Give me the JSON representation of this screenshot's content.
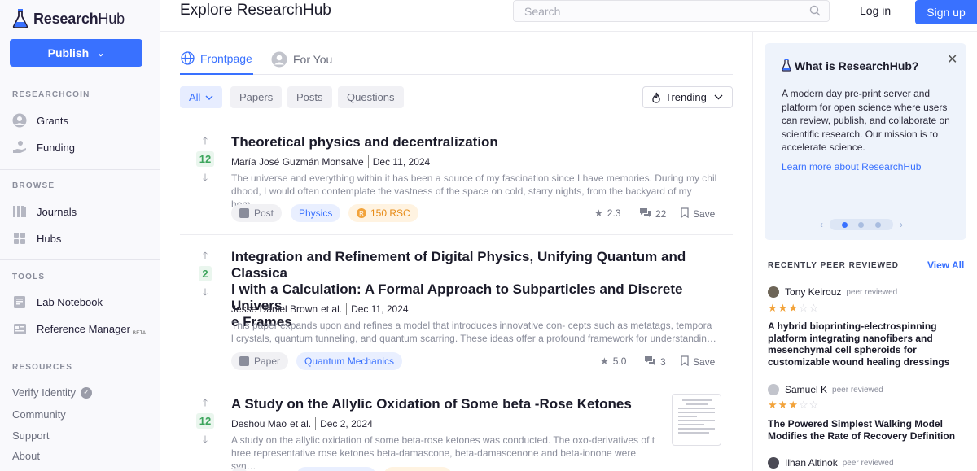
{
  "app": {
    "logo_bold": "Research",
    "logo_light": "Hub",
    "page_title": "Explore ResearchHub"
  },
  "header": {
    "search_placeholder": "Search",
    "login": "Log in",
    "signup": "Sign up"
  },
  "sidebar": {
    "publish": "Publish",
    "sections": {
      "researchcoin": "RESEARCHCOIN",
      "browse": "BROWSE",
      "tools": "TOOLS",
      "resources": "RESOURCES"
    },
    "researchcoin_items": [
      {
        "label": "Grants",
        "icon": "grants-icon"
      },
      {
        "label": "Funding",
        "icon": "funding-icon"
      }
    ],
    "browse_items": [
      {
        "label": "Journals",
        "icon": "journals-icon"
      },
      {
        "label": "Hubs",
        "icon": "hubs-icon"
      }
    ],
    "tools_items": [
      {
        "label": "Lab Notebook",
        "icon": "notebook-icon"
      },
      {
        "label": "Reference Manager",
        "icon": "reference-icon",
        "badge": "BETA"
      }
    ],
    "resources_items": [
      "Verify Identity",
      "Community",
      "Support",
      "About"
    ]
  },
  "tabs": [
    {
      "label": "Frontpage",
      "active": true
    },
    {
      "label": "For You",
      "active": false
    }
  ],
  "filters": [
    {
      "label": "All",
      "active": true
    },
    {
      "label": "Papers",
      "active": false
    },
    {
      "label": "Posts",
      "active": false
    },
    {
      "label": "Questions",
      "active": false
    }
  ],
  "sort": "Trending",
  "feed": [
    {
      "votes": "12",
      "title": "Theoretical physics and decentralization",
      "authors": "María José Guzmán Monsalve",
      "et_al": "",
      "date": "Dec 11, 2024",
      "excerpt_1": "The universe and everything within it has been a source of my fascination since I have memories. During my chil",
      "excerpt_2": "dhood, I would often contemplate the vastness of the space on cold, starry nights, from the backyard of my hom…",
      "type": "Post",
      "hub": "Physics",
      "rsc": "150 RSC",
      "score": "2.3",
      "comments": "22",
      "save": "Save"
    },
    {
      "votes": "2",
      "title_1": "Integration and Refinement of Digital Physics, Unifying Quantum and Classica",
      "title_2": "l with a Calculation: A Formal Approach to Subparticles and Discrete Univers",
      "title_3": "e Frames",
      "authors": "Jesse Daniel Brown",
      "et_al": "et al.",
      "date": "Dec 11, 2024",
      "excerpt_1": "This paper expands upon and refines a model that introduces innovative con- cepts such as metatags, tempora",
      "excerpt_2": "l crystals, quantum tunneling, and quantum scarring. These ideas offer a profound framework for understandin…",
      "type": "Paper",
      "hub": "Quantum Mechanics",
      "score": "5.0",
      "comments": "3",
      "save": "Save"
    },
    {
      "votes": "12",
      "title": "A Study on the Allylic Oxidation of Some beta -Rose Ketones",
      "authors": "Deshou Mao",
      "et_al": "et al.",
      "date": "Dec 2, 2024",
      "excerpt_1": "A study on the allylic oxidation of some beta-rose ketones was conducted. The oxo-derivatives of t",
      "excerpt_2": "hree representative rose ketones beta-damascone, beta-damascenone and beta-ionone were syn…"
    }
  ],
  "about": {
    "title": "What is ResearchHub?",
    "body": "A modern day pre-print server and platform for open science where users can review, publish, and collaborate on scientific research. Our mission is to accelerate science.",
    "link": "Learn more about ResearchHub"
  },
  "peer": {
    "title": "RECENTLY PEER REVIEWED",
    "view_all": "View All",
    "reviews": [
      {
        "name": "Tony Keirouz",
        "label": "peer reviewed",
        "stars": 3,
        "title": "A hybrid bioprinting-electrospinning platform integrating nanofibers and mesenchymal cell spheroids for customizable wound healing dressings"
      },
      {
        "name": "Samuel K",
        "label": "peer reviewed",
        "stars": 3,
        "title": "The Powered Simplest Walking Model Modifies the Rate of Recovery Definition"
      },
      {
        "name": "Ilhan Altinok",
        "label": "peer reviewed"
      }
    ]
  },
  "colors": {
    "accent": "#3971ff",
    "vote_green": "#3ca55c",
    "rsc_orange": "#e68a15",
    "star": "#f2a33b"
  }
}
